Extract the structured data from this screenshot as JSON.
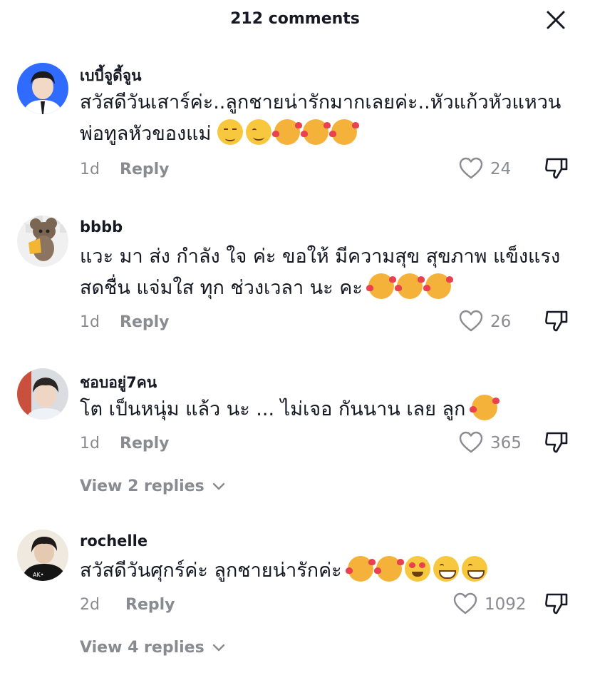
{
  "header": {
    "title": "212 comments"
  },
  "comments": [
    {
      "username": "เบบี้จูดี้จูน",
      "text": "สวัสดีวันเสาร์ค่ะ..ลูกชายน่ารักมากเลยค่ะ..หัวแก้วหัวแหวนพ่อทูลหัวของแม่",
      "emojis": [
        "relieved-face-emoji",
        "smiling-face-emoji",
        "smiling-face-with-hearts-emoji",
        "smiling-face-with-hearts-emoji",
        "smiling-face-with-hearts-emoji"
      ],
      "time": "1d",
      "reply_label": "Reply",
      "likes": "24"
    },
    {
      "username": "bbbb",
      "text": "แวะ มา ส่ง กำลัง ใจ ค่ะ ขอให้ มีความสุข สุขภาพ แข็งแรง สดชื่น แจ่มใส ทุก ช่วงเวลา นะ คะ",
      "emojis": [
        "smiling-face-with-hearts-emoji",
        "smiling-face-with-hearts-emoji",
        "smiling-face-with-hearts-emoji"
      ],
      "time": "1d",
      "reply_label": "Reply",
      "likes": "26"
    },
    {
      "username": "ชอบอยู่7คน",
      "text": "โต เป็นหนุ่ม แล้ว นะ ... ไม่เจอ กันนาน เลย ลูก",
      "emojis": [
        "smiling-face-with-hearts-emoji"
      ],
      "time": "1d",
      "reply_label": "Reply",
      "likes": "365",
      "view_replies": "View 2 replies"
    },
    {
      "username": "rochelle",
      "text": "สวัสดีวันศุกร์ค่ะ ลูกชายน่ารักค่ะ",
      "emojis": [
        "smiling-face-with-hearts-emoji",
        "smiling-face-with-hearts-emoji",
        "heart-eyes-emoji",
        "grinning-face-emoji",
        "grinning-face-emoji"
      ],
      "time": "2d",
      "reply_label": "Reply",
      "likes": "1092",
      "view_replies": "View 4 replies"
    }
  ],
  "colors": {
    "text": "#161823",
    "muted": "#8a8b91",
    "accent_blue": "#2f6bff"
  }
}
